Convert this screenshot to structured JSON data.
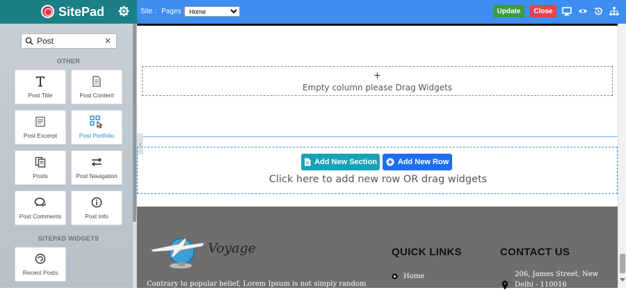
{
  "sidebar": {
    "brand": "SitePad",
    "search": {
      "value": "Post",
      "placeholder": ""
    },
    "groups": [
      {
        "title": "OTHER"
      },
      {
        "title": "SITEPAD WIDGETS"
      }
    ],
    "widgets": [
      {
        "label": "Post Title",
        "icon": "title-icon"
      },
      {
        "label": "Post Content",
        "icon": "document-icon"
      },
      {
        "label": "Post Excerpt",
        "icon": "excerpt-icon"
      },
      {
        "label": "Post Portfolio",
        "icon": "portfolio-icon"
      },
      {
        "label": "Posts",
        "icon": "posts-icon"
      },
      {
        "label": "Post Navigation",
        "icon": "navigation-arrows-icon"
      },
      {
        "label": "Post Comments",
        "icon": "comments-icon"
      },
      {
        "label": "Post Info",
        "icon": "info-icon"
      },
      {
        "label": "Recent Posts",
        "icon": "recent-posts-icon"
      }
    ]
  },
  "topbar": {
    "site_label": "Site :",
    "pages_label": "Pages :",
    "pages_selected": "Home",
    "update_label": "Update",
    "close_label": "Close"
  },
  "canvas": {
    "empty_plus": "+",
    "empty_column_text": "Empty column please Drag Widgets",
    "add_section_label": "Add New Section",
    "add_row_label": "Add New Row",
    "add_hint": "Click here to add new row OR drag widgets"
  },
  "footer": {
    "logo_text": "Voyage",
    "about_text": "Contrary to popular belief, Lorem Ipsum is not simply random",
    "quick_links_title": "QUICK LINKS",
    "contact_title": "CONTACT US",
    "links": [
      "Home"
    ],
    "address_line1": "206, James Street, New",
    "address_line2": "Delhi - 110016"
  },
  "colors": {
    "sidebar_header": "#1b7f86",
    "topbar": "#3d8ef0",
    "update": "#3b9a43",
    "close": "#e8424f",
    "section_button": "#17a2b8",
    "row_button": "#1e6ff0",
    "footer": "#6e6e6e"
  }
}
